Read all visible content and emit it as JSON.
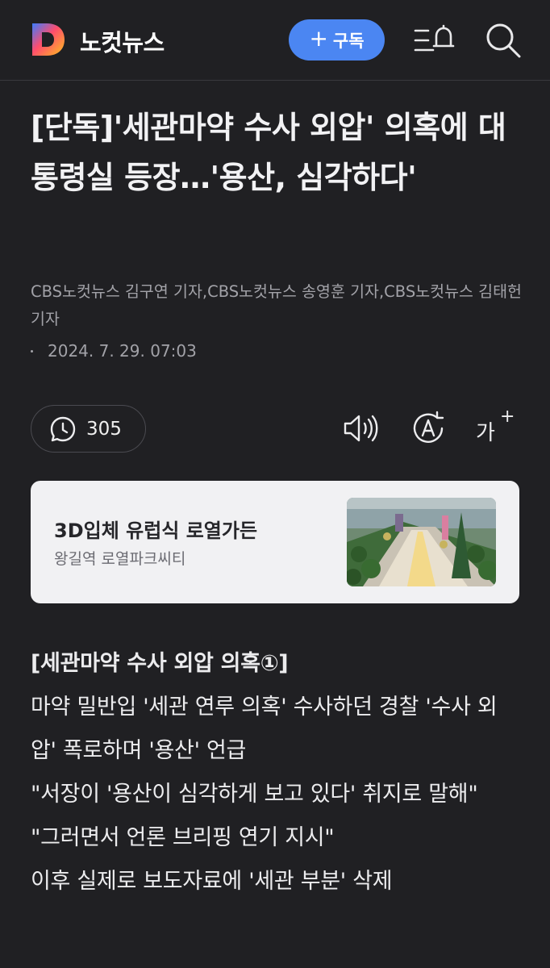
{
  "header": {
    "brand": "노컷뉴스",
    "subscribe_plus": "+",
    "subscribe_label": "구독",
    "menu_icon": "menu-bell-icon",
    "search_icon": "search-icon"
  },
  "article": {
    "title": "[단독]'세관마약 수사 외압' 의혹에 대통령실 등장…'용산, 심각하다'",
    "byline": "CBS노컷뉴스 김구연 기자,CBS노컷뉴스 송영훈 기자,CBS노컷뉴스 김태헌 기자",
    "date": "2024. 7. 29. 07:03",
    "comment_count": "305",
    "tools": {
      "audio_icon": "speaker-icon",
      "translate_icon": "translate-icon",
      "font_label": "가",
      "font_plus": "+"
    },
    "body": [
      "[세관마약 수사 외압 의혹①]",
      "마약 밀반입 '세관 연루 의혹' 수사하던 경찰 '수사 외압' 폭로하며 '용산' 언급",
      "\"서장이 '용산이 심각하게 보고 있다' 취지로 말해\"",
      "\"그러면서 언론 브리핑 연기 지시\"",
      "이후 실제로 보도자료에 '세관 부분' 삭제"
    ]
  },
  "ad": {
    "title": "3D입체 유럽식 로열가든",
    "subtitle": "왕길역 로열파크씨티"
  },
  "colors": {
    "background": "#202023",
    "accent": "#4b86f2",
    "card": "#f1f1f3"
  }
}
